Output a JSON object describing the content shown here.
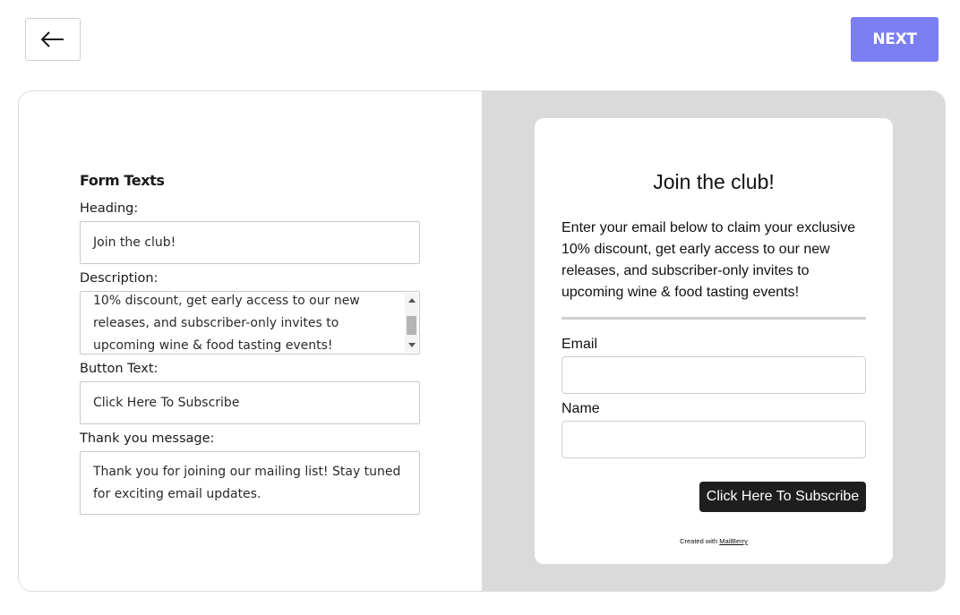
{
  "topbar": {
    "back_icon": "arrow-left-icon",
    "next_label": "NEXT",
    "accent_color": "#7b7ff2"
  },
  "form": {
    "section_title": "Form Texts",
    "heading_label": "Heading:",
    "heading_value": "Join the club!",
    "description_label": "Description:",
    "description_visible": "10% discount, get early access to our new\nreleases, and subscriber-only invites to\nupcoming wine & food tasting events!",
    "button_text_label": "Button Text:",
    "button_text_value": "Click Here To Subscribe",
    "thanks_label": "Thank you message:",
    "thanks_value": "Thank you for joining our mailing list! Stay tuned for exciting email updates."
  },
  "preview": {
    "heading": "Join the club!",
    "description": "Enter your email below to claim your exclusive 10% discount, get early access to our new releases, and subscriber-only invites to upcoming wine & food tasting events!",
    "email_label": "Email",
    "name_label": "Name",
    "submit_label": "Click Here To Subscribe",
    "credit_prefix": "Created with",
    "credit_link": "MailBerry",
    "button_color": "#1e1e1e",
    "background_color": "#dadada"
  }
}
